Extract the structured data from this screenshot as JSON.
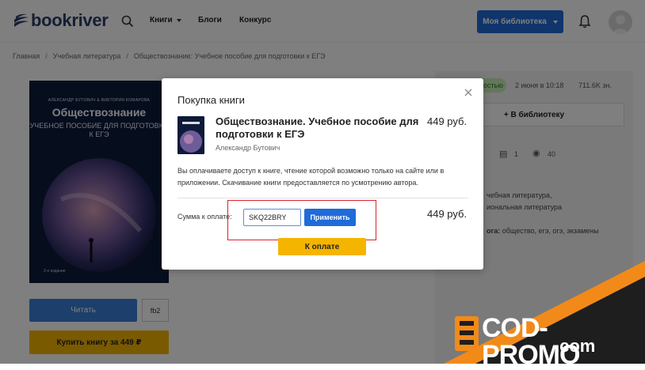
{
  "header": {
    "logo_text": "bookriver",
    "nav": {
      "books": "Книги",
      "blogs": "Блоги",
      "contest": "Конкурс"
    },
    "library_button": "Моя библиотека"
  },
  "breadcrumb": [
    "Главная",
    "Учебная литература",
    "Обществознание: Учебное пособие для подготовки к ЕГЭ"
  ],
  "background_page": {
    "cover": {
      "authors": "АЛЕКСАНДР БУТОВИЧ & ВИКТОРИЯ КОМАРОВА",
      "title": "Обществознание",
      "subtitle": "УЧЕБНОЕ ПОСОБИЕ ДЛЯ ПОДГОТОВКИ К ЕГЭ",
      "edition": "2-е издание"
    },
    "read_button": "Читать",
    "format_button": "fb2",
    "buy_button": "Купить книгу за 449 ₽",
    "status_badge": "тостью",
    "date": "2 июня в 10:18",
    "chars": "711.6K зн.",
    "add_to_library": "+ В библиотеку",
    "stats": {
      "pages": "1",
      "views": "40"
    },
    "genres_line1": "чебная литература,",
    "genres_line2": "иональная литература",
    "tags_label": "ога:",
    "tags_value": "общество, егэ, огэ, экзамены"
  },
  "modal": {
    "title": "Покупка книги",
    "book_title": "Обществознание. Учебное пособие для подготовки к ЕГЭ",
    "book_price": "449 руб.",
    "author": "Александр Бутович",
    "info": "Вы оплачиваете доступ к книге, чтение которой возможно только на сайте или в приложении. Скачивание книги предоставляется по усмотрению автора.",
    "sum_label": "Сумма к оплате:",
    "promo_code": "SKQ22BRY",
    "apply_button": "Применить",
    "sum_value": "449 руб.",
    "pay_button": "К оплате"
  },
  "watermark": {
    "line1": "COD-PROMO",
    "line2": ".com"
  },
  "colors": {
    "accent_blue": "#1f6bd9",
    "pay_yellow": "#f5b400",
    "highlight_red": "#d9232e",
    "watermark_orange": "#f28a1a"
  }
}
